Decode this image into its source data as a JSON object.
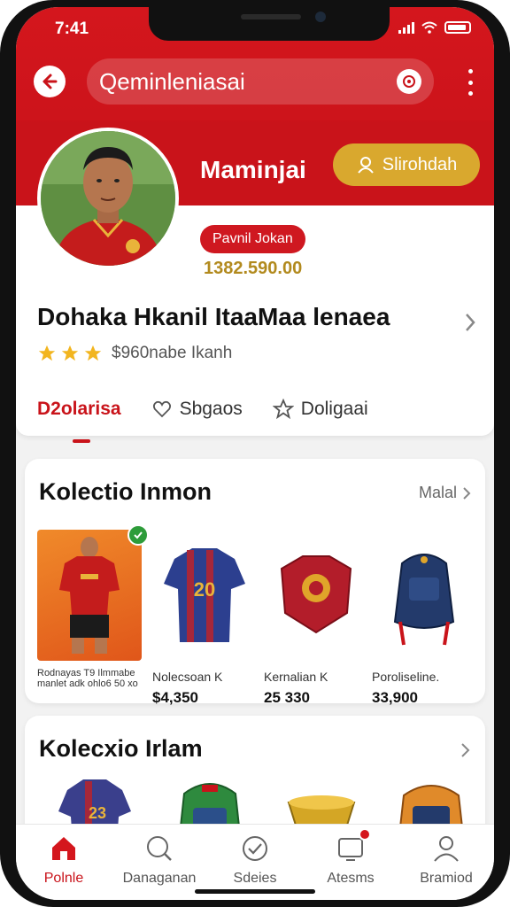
{
  "status": {
    "time": "7:41"
  },
  "search": {
    "placeholder": "Qeminleniasai"
  },
  "profile": {
    "username": "Maminjai",
    "follow_label": "Slirohdah",
    "tag": "Pavnil Jokan",
    "points": "1382.590.00",
    "full_name": "Dohaka Hkanil ItaaMaa lenaea",
    "stars_text": "$960nabe Ikanh",
    "rating": 3
  },
  "tabs": [
    {
      "label": "D2olarisa",
      "icon": ""
    },
    {
      "label": "Sbgaos",
      "icon": "heart-icon"
    },
    {
      "label": "Doligaai",
      "icon": "star-outline-icon"
    }
  ],
  "section1": {
    "title": "Kolectio Inmon",
    "more_label": "Malal",
    "items": [
      {
        "name": "Rodnayas T9 Ilmmabe manlet adk ohlo6 50 xo",
        "price": "",
        "icon": "player-jersey-icon"
      },
      {
        "name": "Nolecsoan K",
        "price": "$4,350",
        "icon": "blue-jersey-icon"
      },
      {
        "name": "Kernalian K",
        "price": "25 330",
        "icon": "shoulder-armor-icon"
      },
      {
        "name": "Poroliseline.",
        "price": "33,900",
        "icon": "backpack-icon"
      }
    ]
  },
  "section2": {
    "title": "Kolecxio Irlam",
    "items": [
      {
        "icon": "jersey-icon"
      },
      {
        "icon": "green-backpack-icon"
      },
      {
        "icon": "gold-bowl-icon"
      },
      {
        "icon": "orange-backpack-icon"
      }
    ]
  },
  "nav": [
    {
      "label": "Polnle",
      "icon": "home-icon",
      "active": true
    },
    {
      "label": "Danaganan",
      "icon": "search-icon",
      "active": false
    },
    {
      "label": "Sdeies",
      "icon": "scan-icon",
      "active": false
    },
    {
      "label": "Atesms",
      "icon": "inbox-icon",
      "active": false
    },
    {
      "label": "Bramiod",
      "icon": "profile-icon",
      "active": false
    }
  ],
  "colors": {
    "brand_red": "#d4161d",
    "gold": "#d9a82e",
    "points_gold": "#b28a1e"
  }
}
